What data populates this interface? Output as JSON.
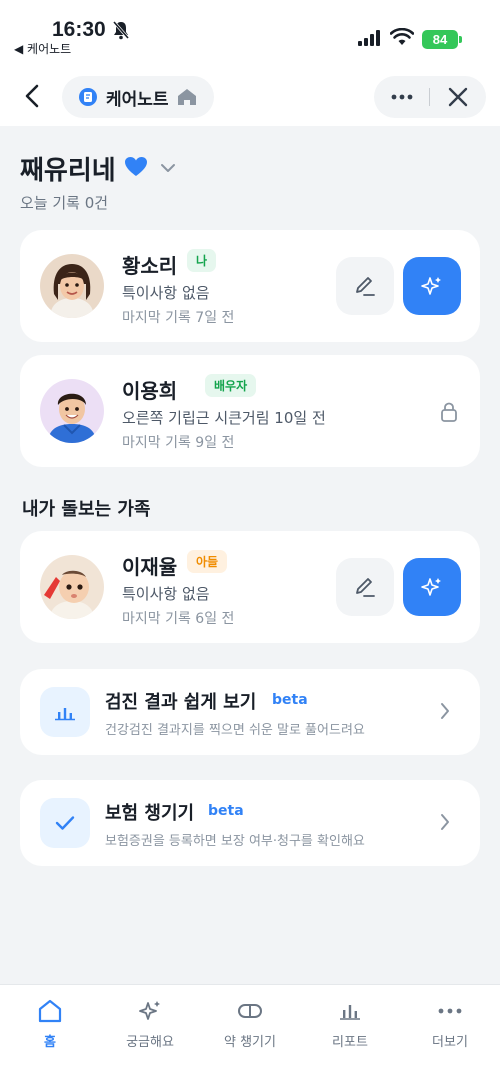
{
  "status_bar": {
    "time": "16:30",
    "back_app": "◀ 케어노트",
    "battery": "84"
  },
  "nav": {
    "title": "케어노트"
  },
  "header": {
    "family_name": "째유리네",
    "today_records": "오늘 기록 0건"
  },
  "members": [
    {
      "name": "황소리",
      "tag": "나",
      "note": "특이사항 없음",
      "last_record": "마지막 기록 7일 전"
    },
    {
      "name": "이용희",
      "tag": "배우자",
      "note": "오른쪽 기립근 시큰거림 10일 전",
      "last_record": "마지막 기록 9일 전"
    }
  ],
  "care_section": {
    "title": "내가 돌보는 가족",
    "members": [
      {
        "name": "이재율",
        "tag": "아들",
        "note": "특이사항 없음",
        "last_record": "마지막 기록 6일 전"
      }
    ]
  },
  "features": [
    {
      "title": "검진 결과 쉽게 보기",
      "badge": "beta",
      "desc": "건강검진 결과지를 찍으면 쉬운 말로 풀어드려요",
      "icon": "chart-icon"
    },
    {
      "title": "보험 챙기기",
      "badge": "beta",
      "desc": "보험증권을 등록하면 보장 여부·청구를 확인해요",
      "icon": "check-icon"
    }
  ],
  "tabs": [
    {
      "label": "홈",
      "icon": "home-icon",
      "active": true
    },
    {
      "label": "궁금해요",
      "icon": "sparkle-icon",
      "active": false
    },
    {
      "label": "약 챙기기",
      "icon": "pill-icon",
      "active": false
    },
    {
      "label": "리포트",
      "icon": "chart-icon",
      "active": false
    },
    {
      "label": "더보기",
      "icon": "more-icon",
      "active": false
    }
  ],
  "colors": {
    "accent": "#3182f6",
    "background": "#f2f4f6",
    "card": "#ffffff",
    "tag_green": "#14a44d",
    "tag_orange": "#f08c00"
  }
}
